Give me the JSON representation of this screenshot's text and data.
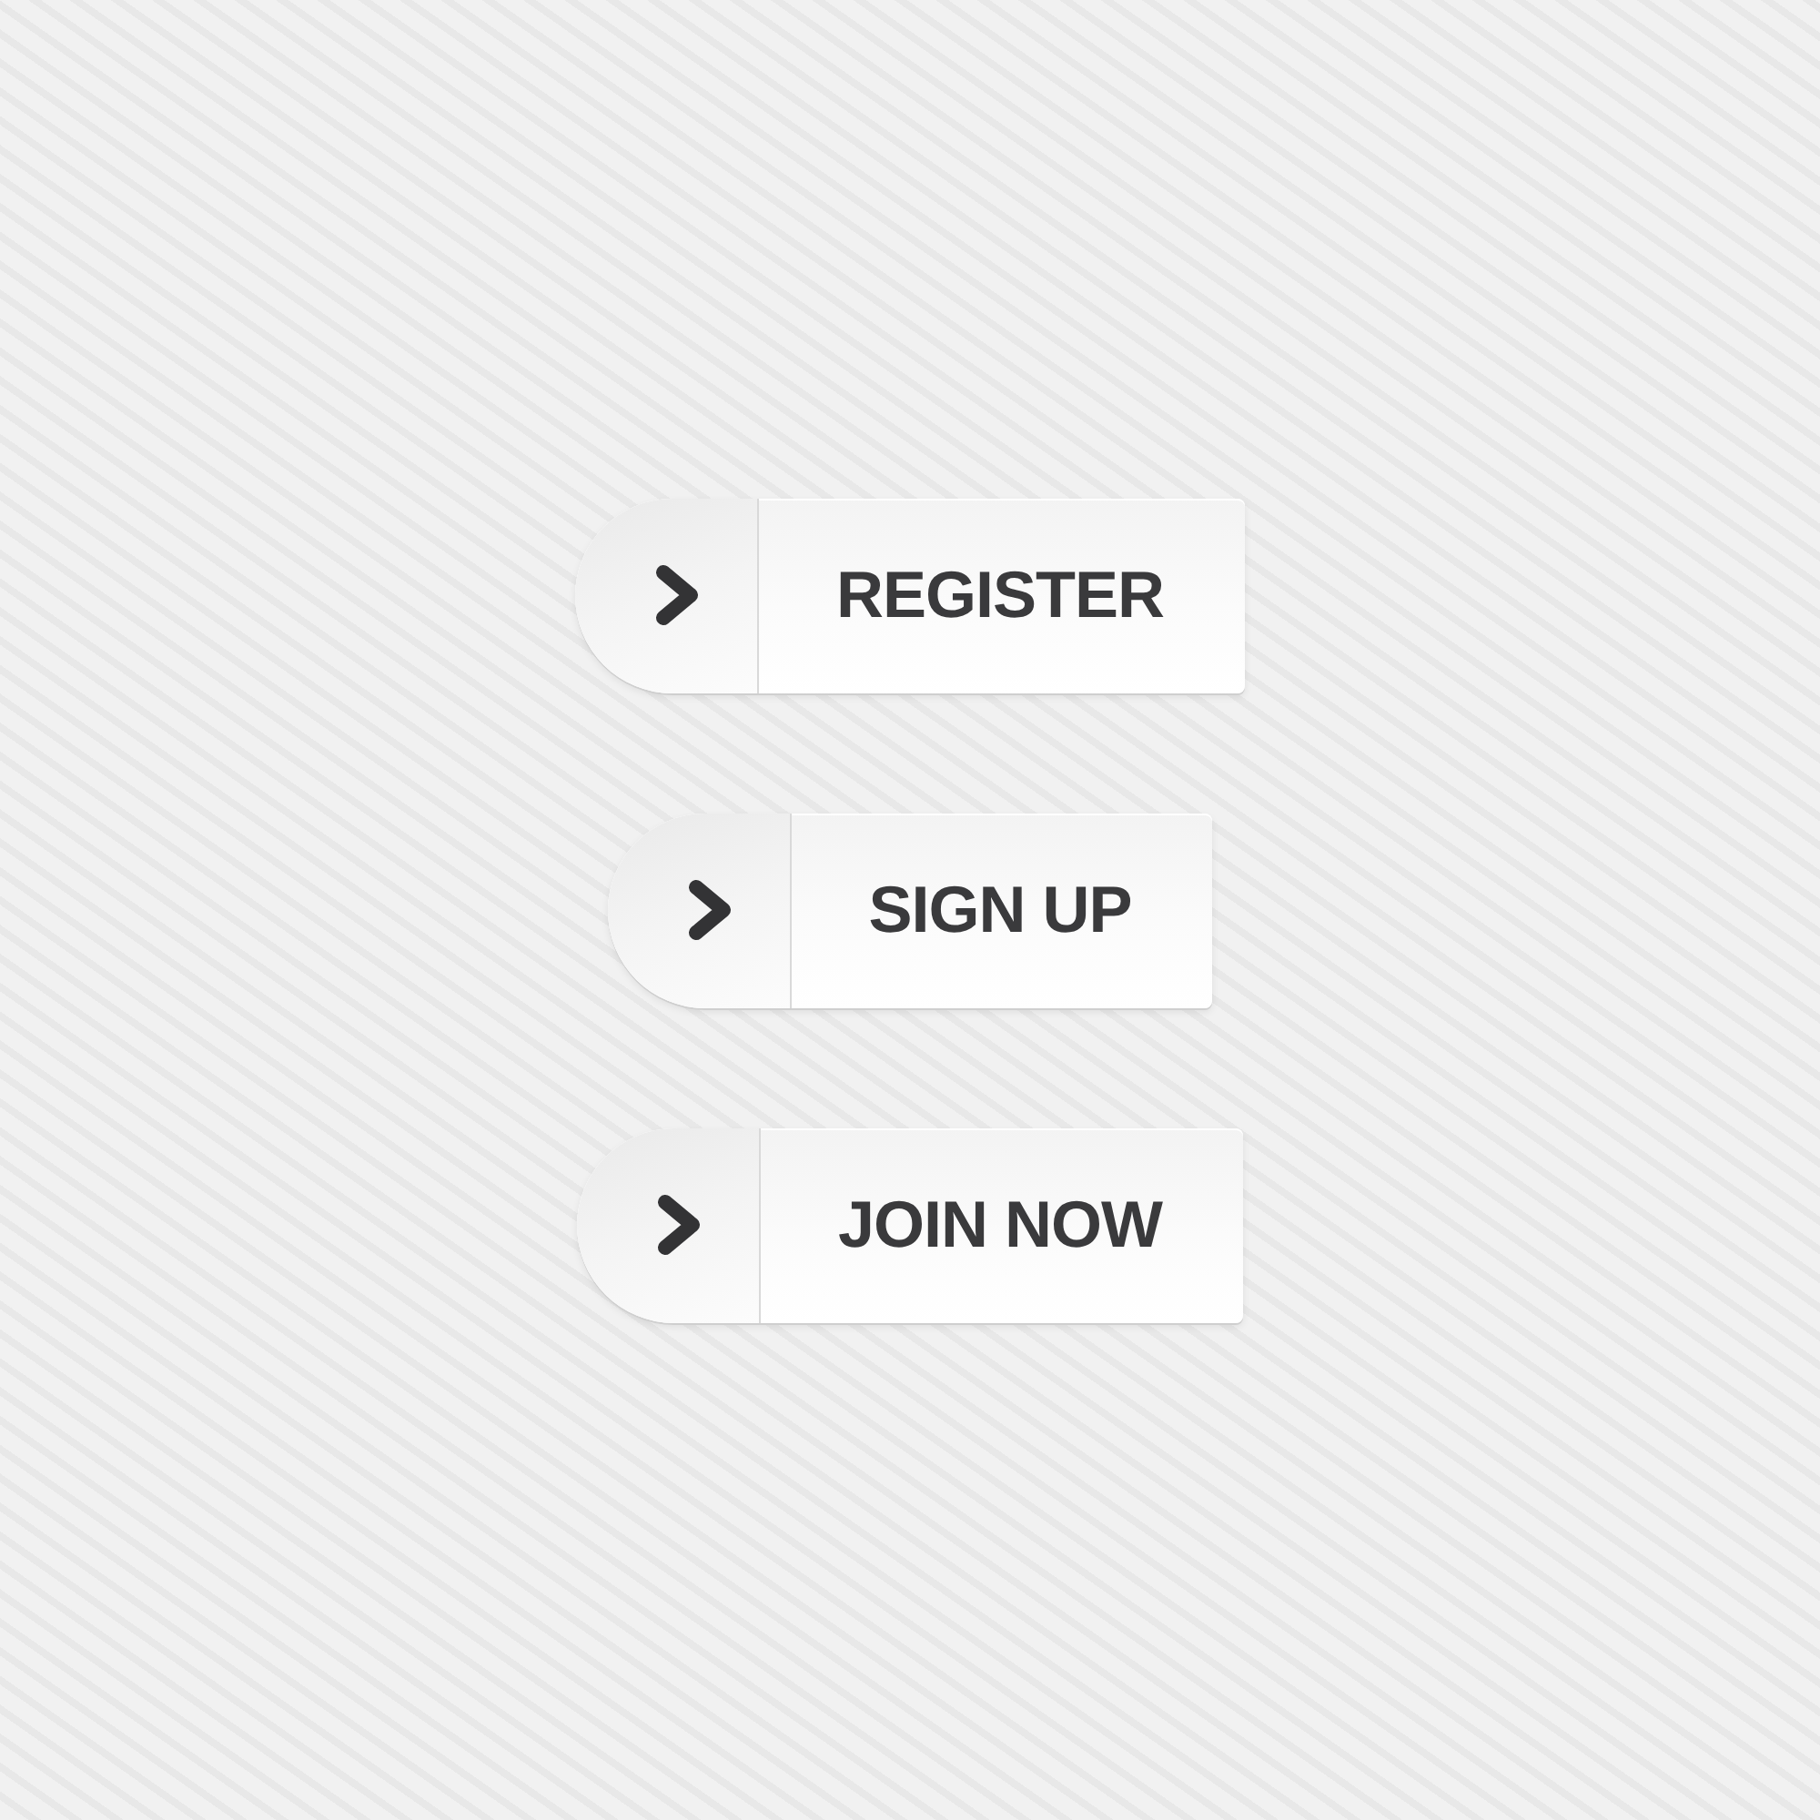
{
  "buttons": [
    {
      "label": "REGISTER"
    },
    {
      "label": "SIGN UP"
    },
    {
      "label": "JOIN NOW"
    }
  ]
}
